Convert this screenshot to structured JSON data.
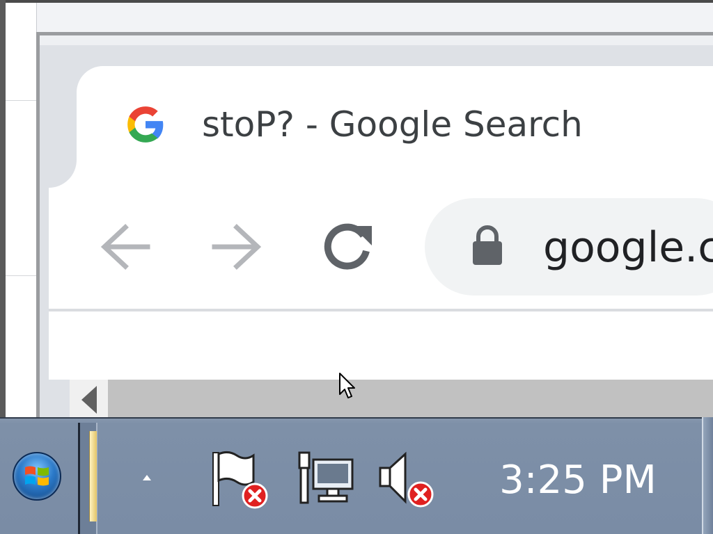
{
  "browser": {
    "tab": {
      "title": "stoP? - Google Search",
      "favicon": "google-g-icon"
    },
    "toolbar": {
      "back_icon": "arrow-left-icon",
      "forward_icon": "arrow-right-icon",
      "reload_icon": "reload-icon",
      "omnibox": {
        "security_icon": "lock-icon",
        "url_visible": "google.c"
      }
    }
  },
  "taskbar": {
    "start_icon": "windows-start-orb-icon",
    "tray": {
      "overflow_icon": "chevron-up-icon",
      "icons": [
        "action-center-flag-error-icon",
        "network-disconnected-icon",
        "volume-muted-error-icon"
      ]
    },
    "clock": "3:25 PM"
  },
  "colors": {
    "tab_bg": "#ffffff",
    "frame_bg": "#dee1e6",
    "omnibox_bg": "#f1f3f4",
    "taskbar_bg": "#7a8ca5",
    "error_red": "#e02020",
    "google_blue": "#4285f4",
    "google_red": "#ea4335",
    "google_yellow": "#fbbc05",
    "google_green": "#34a853"
  }
}
